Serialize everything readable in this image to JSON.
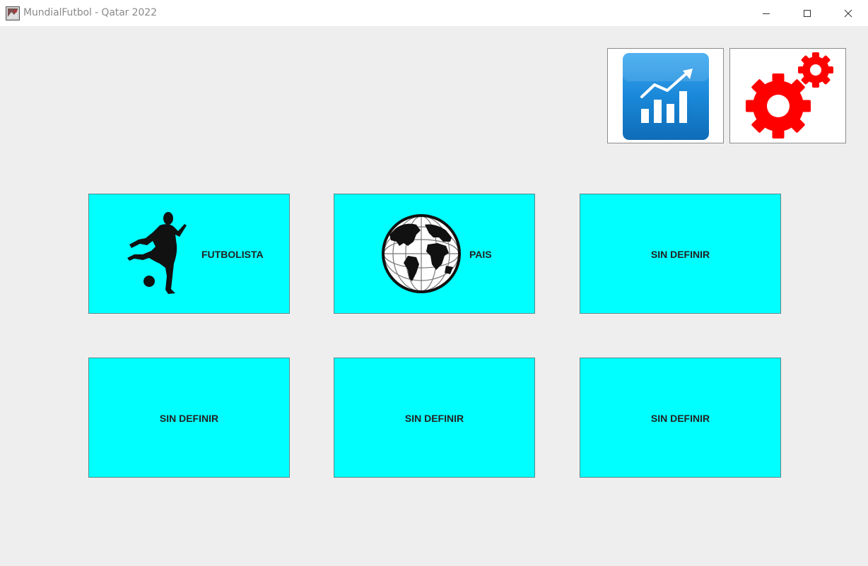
{
  "window": {
    "title": "MundialFutbol - Qatar 2022",
    "controls": [
      "minimize",
      "maximize",
      "close"
    ]
  },
  "toolbar": {
    "buttons": [
      {
        "name": "stats",
        "icon": "bar-chart-trend-icon",
        "color": "#1a88d8"
      },
      {
        "name": "settings",
        "icon": "gears-icon",
        "color": "#ff0000"
      }
    ]
  },
  "tiles": [
    {
      "label": "FUTBOLISTA",
      "icon": "soccer-player-icon"
    },
    {
      "label": "PAIS",
      "icon": "globe-icon"
    },
    {
      "label": "SIN DEFINIR"
    },
    {
      "label": "SIN DEFINIR"
    },
    {
      "label": "SIN DEFINIR"
    },
    {
      "label": "SIN DEFINIR"
    }
  ],
  "colors": {
    "tile_background": "#00ffff",
    "window_background": "#eeeeee"
  }
}
